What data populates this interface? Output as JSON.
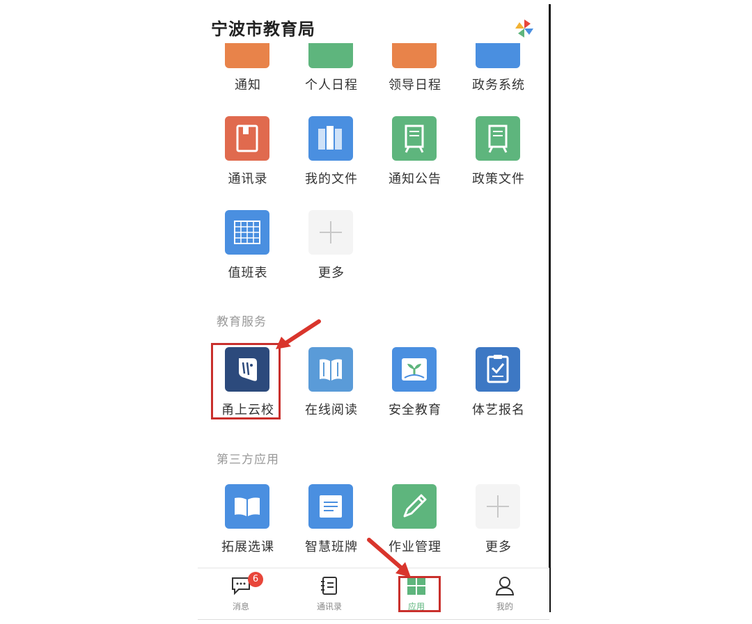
{
  "header": {
    "title": "宁波市教育局",
    "logo_icon": "pinwheel-icon"
  },
  "row1": [
    {
      "label": "通知",
      "icon": "notice-icon",
      "color": "#e8834a"
    },
    {
      "label": "个人日程",
      "icon": "calendar-icon",
      "color": "#5eb57d"
    },
    {
      "label": "领导日程",
      "icon": "briefcase-icon",
      "color": "#e8834a"
    },
    {
      "label": "政务系统",
      "icon": "system-icon",
      "color": "#4a8fe0"
    }
  ],
  "row2": [
    {
      "label": "通讯录",
      "icon": "address-book-icon",
      "color": "#e06a4e"
    },
    {
      "label": "我的文件",
      "icon": "files-icon",
      "color": "#4a8fe0"
    },
    {
      "label": "通知公告",
      "icon": "board-icon",
      "color": "#5eb57d"
    },
    {
      "label": "政策文件",
      "icon": "board-icon",
      "color": "#5eb57d"
    }
  ],
  "row3": [
    {
      "label": "值班表",
      "icon": "table-icon",
      "color": "#4a8fe0"
    },
    {
      "label": "更多",
      "icon": "plus-icon",
      "color": "#f4f4f4"
    }
  ],
  "sections": {
    "education": "教育服务",
    "third_party": "第三方应用"
  },
  "education": [
    {
      "label": "甬上云校",
      "icon": "cloud-school-icon",
      "color": "#2c4a7c"
    },
    {
      "label": "在线阅读",
      "icon": "book-icon",
      "color": "#5a9bd8"
    },
    {
      "label": "安全教育",
      "icon": "sprout-icon",
      "color": "#4a8fe0"
    },
    {
      "label": "体艺报名",
      "icon": "clipboard-icon",
      "color": "#3d78c4"
    }
  ],
  "third_party": [
    {
      "label": "拓展选课",
      "icon": "open-book-icon",
      "color": "#4a8fe0"
    },
    {
      "label": "智慧班牌",
      "icon": "document-icon",
      "color": "#4a8fe0"
    },
    {
      "label": "作业管理",
      "icon": "pencil-icon",
      "color": "#5eb57d"
    },
    {
      "label": "更多",
      "icon": "plus-icon",
      "color": "#f4f4f4"
    }
  ],
  "tabbar": {
    "messages": "消息",
    "messages_badge": "6",
    "contacts": "通讯录",
    "apps": "应用",
    "me": "我的"
  },
  "colors": {
    "highlight": "#c9302c",
    "apps_tab": "#5eb57d"
  }
}
